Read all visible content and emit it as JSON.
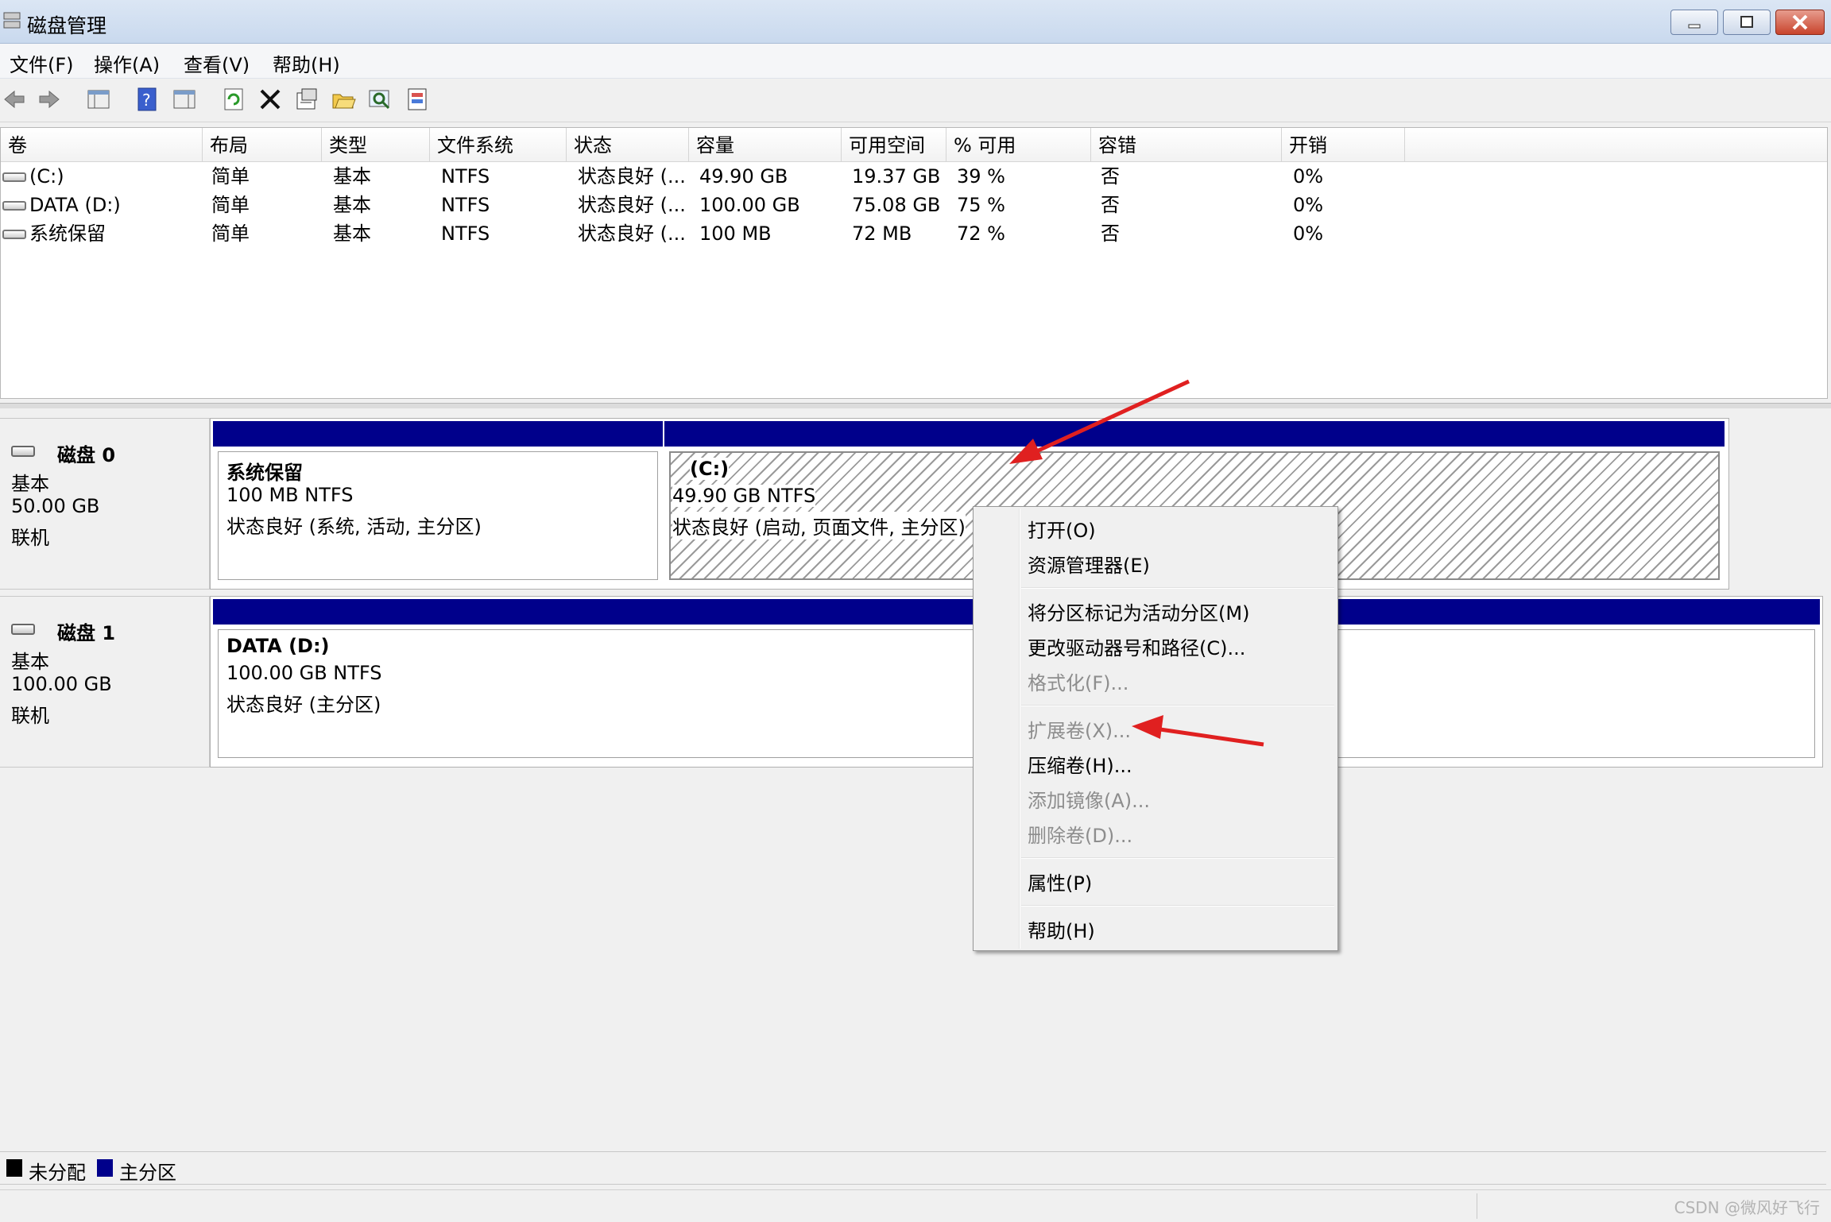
{
  "window": {
    "title": "磁盘管理"
  },
  "menubar": {
    "items": [
      "文件(F)",
      "操作(A)",
      "查看(V)",
      "帮助(H)"
    ]
  },
  "toolbar": {
    "icons": [
      "back-arrow-icon",
      "forward-arrow-icon",
      "console-tree-icon",
      "help-icon",
      "show-hide-icon",
      "refresh-icon",
      "delete-icon",
      "properties-icon",
      "open-folder-icon",
      "search-icon",
      "export-icon"
    ]
  },
  "volumes": {
    "columns": [
      "卷",
      "布局",
      "类型",
      "文件系统",
      "状态",
      "容量",
      "可用空间",
      "% 可用",
      "容错",
      "开销"
    ],
    "rows": [
      {
        "volume": "(C:)",
        "layout": "简单",
        "type": "基本",
        "fs": "NTFS",
        "status": "状态良好 (...",
        "capacity": "49.90 GB",
        "free": "19.37 GB",
        "pct": "39 %",
        "fault": "否",
        "overhead": "0%"
      },
      {
        "volume": "DATA (D:)",
        "layout": "简单",
        "type": "基本",
        "fs": "NTFS",
        "status": "状态良好 (...",
        "capacity": "100.00 GB",
        "free": "75.08 GB",
        "pct": "75 %",
        "fault": "否",
        "overhead": "0%"
      },
      {
        "volume": "系统保留",
        "layout": "简单",
        "type": "基本",
        "fs": "NTFS",
        "status": "状态良好 (...",
        "capacity": "100 MB",
        "free": "72 MB",
        "pct": "72 %",
        "fault": "否",
        "overhead": "0%"
      }
    ]
  },
  "disks": [
    {
      "name": "磁盘 0",
      "type": "基本",
      "size": "50.00 GB",
      "state": "联机",
      "partitions": [
        {
          "title": "系统保留",
          "detail": "100 MB NTFS",
          "status": "状态良好 (系统, 活动, 主分区)"
        },
        {
          "title": "(C:)",
          "detail": "49.90 GB NTFS",
          "status": "状态良好 (启动, 页面文件, 主分区)"
        }
      ]
    },
    {
      "name": "磁盘 1",
      "type": "基本",
      "size": "100.00 GB",
      "state": "联机",
      "partitions": [
        {
          "title": "DATA  (D:)",
          "detail": "100.00 GB NTFS",
          "status": "状态良好 (主分区)"
        }
      ]
    }
  ],
  "context_menu": {
    "items": [
      {
        "label": "打开(O)",
        "enabled": true
      },
      {
        "label": "资源管理器(E)",
        "enabled": true
      },
      {
        "label": "将分区标记为活动分区(M)",
        "enabled": true
      },
      {
        "label": "更改驱动器号和路径(C)...",
        "enabled": true
      },
      {
        "label": "格式化(F)...",
        "enabled": false
      },
      {
        "label": "扩展卷(X)...",
        "enabled": false
      },
      {
        "label": "压缩卷(H)...",
        "enabled": true
      },
      {
        "label": "添加镜像(A)...",
        "enabled": false
      },
      {
        "label": "删除卷(D)...",
        "enabled": false
      },
      {
        "label": "属性(P)",
        "enabled": true
      },
      {
        "label": "帮助(H)",
        "enabled": true
      }
    ]
  },
  "legend": {
    "items": [
      {
        "label": "未分配",
        "color": "#000000"
      },
      {
        "label": "主分区",
        "color": "#00008b"
      }
    ]
  },
  "watermark": "CSDN @微风好飞行",
  "colors": {
    "partition_bar": "#00008b",
    "annotation_arrow": "#e02020"
  }
}
